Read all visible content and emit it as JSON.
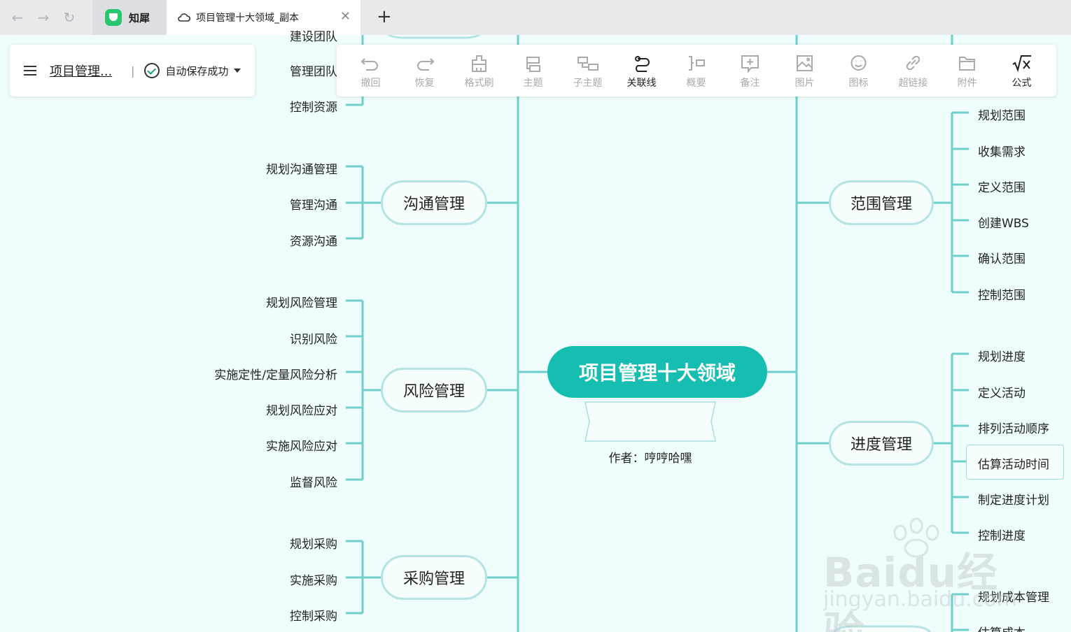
{
  "browser": {
    "tab1": {
      "label": "知犀",
      "logo": "zhixi-logo"
    },
    "tab2": {
      "label": "项目管理十大领域_副本",
      "icon": "cloud-icon"
    }
  },
  "doc": {
    "title": "项目管理...",
    "separator": "|",
    "save_status": "自动保存成功"
  },
  "toolbar": {
    "items": [
      {
        "label": "撤回",
        "icon": "undo-icon",
        "active": false
      },
      {
        "label": "恢复",
        "icon": "redo-icon",
        "active": false
      },
      {
        "label": "格式刷",
        "icon": "format-brush-icon",
        "active": false
      },
      {
        "label": "主题",
        "icon": "topic-icon",
        "active": false
      },
      {
        "label": "子主题",
        "icon": "subtopic-icon",
        "active": false
      },
      {
        "label": "关联线",
        "icon": "relation-line-icon",
        "active": true
      },
      {
        "label": "概要",
        "icon": "summary-icon",
        "active": false
      },
      {
        "label": "备注",
        "icon": "note-icon",
        "active": false
      },
      {
        "label": "图片",
        "icon": "image-icon",
        "active": false
      },
      {
        "label": "图标",
        "icon": "emoji-icon",
        "active": false
      },
      {
        "label": "超链接",
        "icon": "link-icon",
        "active": false
      },
      {
        "label": "附件",
        "icon": "folder-icon",
        "active": false
      },
      {
        "label": "公式",
        "icon": "formula-icon",
        "active": true
      }
    ]
  },
  "mindmap": {
    "root": "项目管理十大领域",
    "author_note": "作者：哼哼哈嘿",
    "line_color": "#6fcfca",
    "root_color": "#16bdb1",
    "left": {
      "partial_items": [
        "建设团队",
        "管理团队",
        "控制资源"
      ],
      "communication": {
        "label": "沟通管理",
        "items": [
          "规划沟通管理",
          "管理沟通",
          "资源沟通"
        ]
      },
      "risk": {
        "label": "风险管理",
        "items": [
          "规划风险管理",
          "识别风险",
          "实施定性/定量风险分析",
          "规划风险应对",
          "实施风险应对",
          "监督风险"
        ]
      },
      "procurement": {
        "label": "采购管理",
        "items": [
          "规划采购",
          "实施采购",
          "控制采购"
        ]
      }
    },
    "right": {
      "scope": {
        "label": "范围管理",
        "items": [
          "规划范围",
          "收集需求",
          "定义范围",
          "创建WBS",
          "确认范围",
          "控制范围"
        ]
      },
      "schedule": {
        "label": "进度管理",
        "items": [
          "规划进度",
          "定义活动",
          "排列活动顺序",
          "估算活动时间",
          "制定进度计划",
          "控制进度"
        ]
      },
      "cost_partial": [
        "规划成本管理",
        "估算成本"
      ]
    }
  },
  "watermark": {
    "brand": "Baidu经验",
    "url": "jingyan.baidu.com"
  }
}
